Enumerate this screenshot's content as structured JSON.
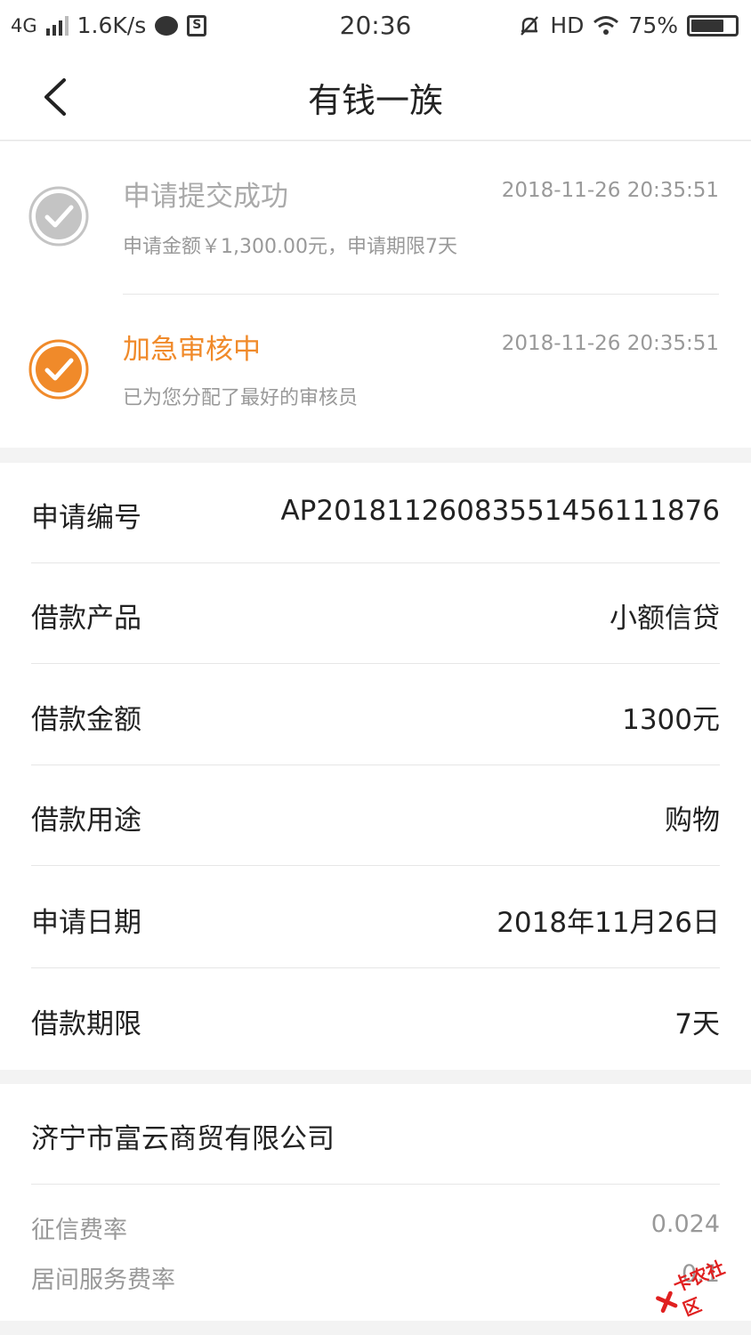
{
  "status_bar": {
    "network": "4G",
    "speed": "1.6K/s",
    "time": "20:36",
    "hd": "HD",
    "battery": "75%",
    "battery_level": 0.75
  },
  "header": {
    "title": "有钱一族"
  },
  "progress": [
    {
      "title": "申请提交成功",
      "time": "2018-11-26 20:35:51",
      "desc": "申请金额￥1,300.00元，申请期限7天",
      "state": "done",
      "color": "#c4c4c4"
    },
    {
      "title": "加急审核中",
      "time": "2018-11-26 20:35:51",
      "desc": "已为您分配了最好的审核员",
      "state": "current",
      "color": "#f08a2a"
    }
  ],
  "details": [
    {
      "label": "申请编号",
      "value": "AP20181126083551456111876"
    },
    {
      "label": "借款产品",
      "value": "小额信贷"
    },
    {
      "label": "借款金额",
      "value": "1300元"
    },
    {
      "label": "借款用途",
      "value": "购物"
    },
    {
      "label": "申请日期",
      "value": "2018年11月26日"
    },
    {
      "label": "借款期限",
      "value": "7天"
    }
  ],
  "company": {
    "name": "济宁市富云商贸有限公司",
    "fees": [
      {
        "label": "征信费率",
        "value": "0.024"
      },
      {
        "label": "居间服务费率",
        "value": "0.1"
      }
    ]
  },
  "watermark": {
    "text": "卡农社区"
  },
  "colors": {
    "accent": "#f08a2a",
    "muted": "#999999",
    "done_gray": "#c4c4c4"
  }
}
